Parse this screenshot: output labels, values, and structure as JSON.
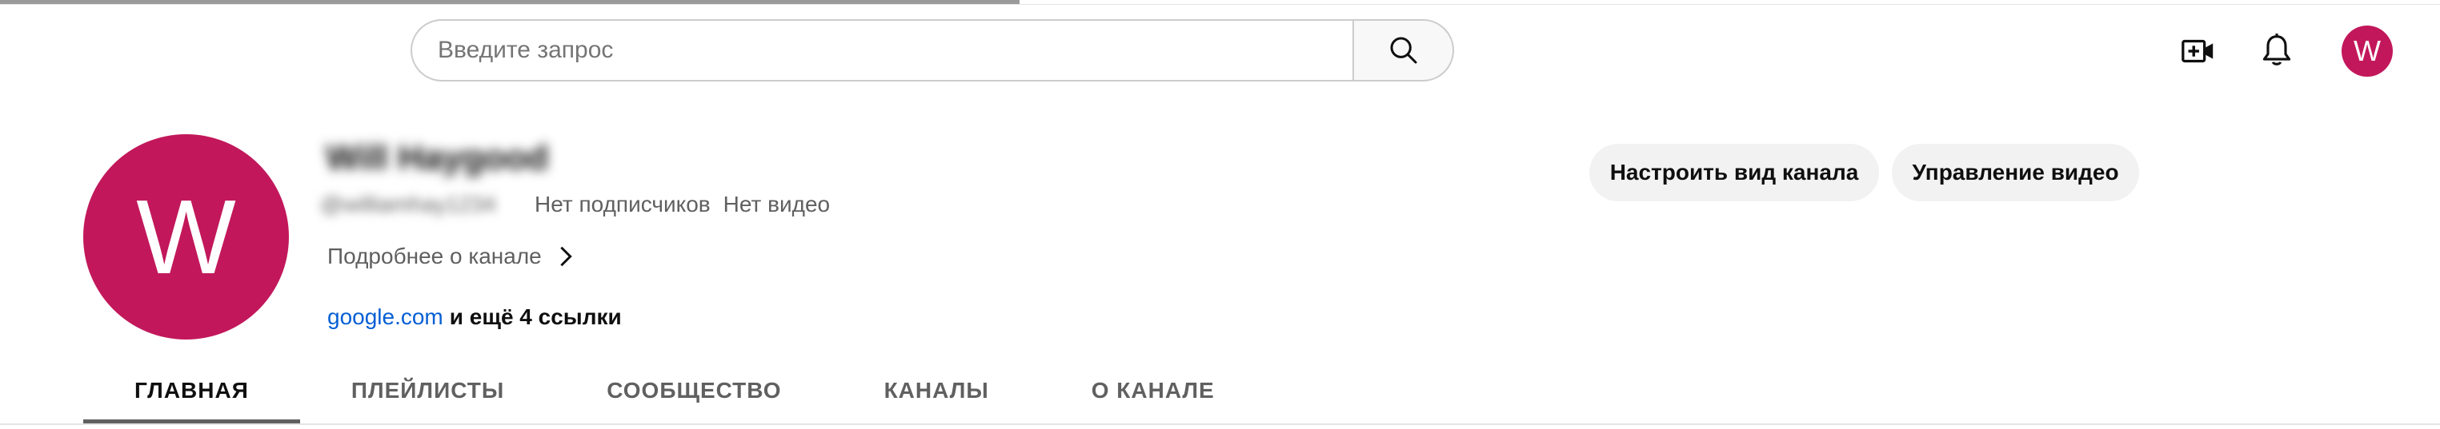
{
  "progress": {
    "fraction": 0.418,
    "color": "#9a9a9a"
  },
  "header": {
    "search": {
      "placeholder": "Введите запрос",
      "value": ""
    },
    "icons": [
      "search-icon",
      "create-video-icon",
      "bell-icon"
    ],
    "user_avatar_letter": "W"
  },
  "channel": {
    "avatar_letter": "W",
    "avatar_color": "#c2185b",
    "name_blurred": "Will Haygood",
    "handle_blurred": "@williamhay1234",
    "subscribers": "Нет подписчиков",
    "videos": "Нет видео",
    "about_label": "Подробнее о канале",
    "link_main": "google.com",
    "link_more": "и ещё 4 ссылки",
    "buttons": {
      "customize": "Настроить вид канала",
      "manage": "Управление видео"
    }
  },
  "tabs": [
    {
      "label": "ГЛАВНАЯ",
      "active": true
    },
    {
      "label": "ПЛЕЙЛИСТЫ",
      "active": false
    },
    {
      "label": "СООБЩЕСТВО",
      "active": false
    },
    {
      "label": "КАНАЛЫ",
      "active": false
    },
    {
      "label": "О КАНАЛЕ",
      "active": false
    }
  ],
  "colors": {
    "accent_link": "#065fd4",
    "pill_bg": "#f2f2f2",
    "secondary_text": "#606060"
  }
}
